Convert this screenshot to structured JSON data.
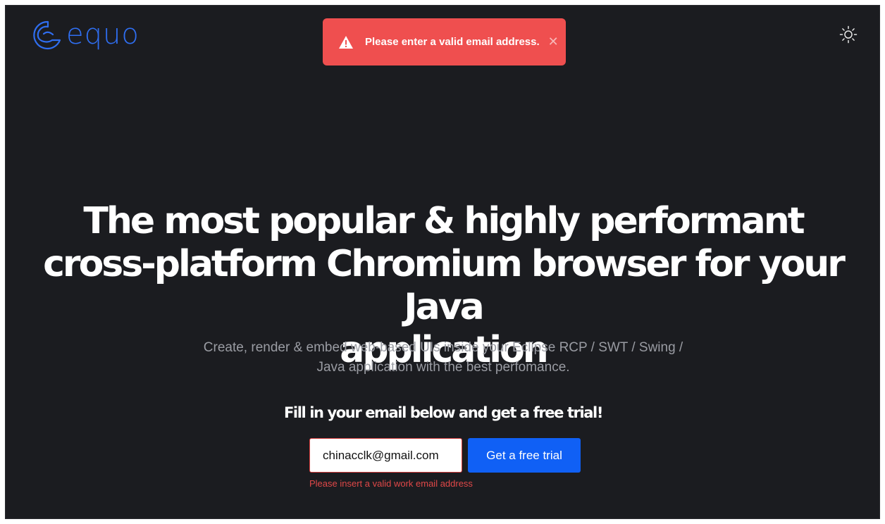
{
  "header": {
    "logo_text": "equo",
    "theme_toggle_icon": "sun-icon"
  },
  "toast": {
    "icon": "warning-icon",
    "message": "Please enter a valid email address.",
    "close_label": "✕",
    "background": "#ef4f4f"
  },
  "hero": {
    "headline_line1": "The most popular & highly performant",
    "headline_line2": "cross-platform Chromium browser for your Java",
    "headline_line3": "application",
    "subtitle_line1": "Create, render & embed web-based UIs inside your Eclipse RCP / SWT / Swing /",
    "subtitle_line2": "Java application with the best perfomance."
  },
  "signup": {
    "heading": "Fill in your email below and get a free trial!",
    "email_value": "chinacclk@gmail.com",
    "button_label": "Get a free trial",
    "error_message": "Please insert a valid work email address",
    "button_color": "#1060f5",
    "error_color": "#e04848"
  }
}
